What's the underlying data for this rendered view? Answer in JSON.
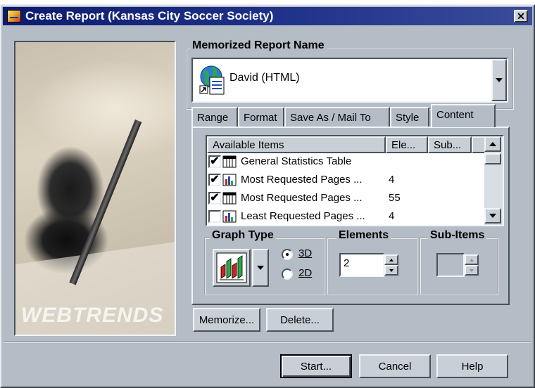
{
  "window": {
    "title": "Create Report (Kansas City Soccer Society)",
    "close_glyph": "✕"
  },
  "photo": {
    "watermark": "WEBTRENDS"
  },
  "memorized_report": {
    "group_label": "Memorized Report Name",
    "selected_value": "David (HTML)"
  },
  "tabs": [
    {
      "label": "Range"
    },
    {
      "label": "Format"
    },
    {
      "label": "Save As / Mail To"
    },
    {
      "label": "Style"
    },
    {
      "label": "Content",
      "active": true
    }
  ],
  "list": {
    "columns": [
      "Available Items",
      "Ele...",
      "Sub..."
    ],
    "rows": [
      {
        "checked": true,
        "icon": "table-icon",
        "name": "General Statistics Table",
        "elements": ""
      },
      {
        "checked": true,
        "icon": "bar-chart-icon",
        "name": "Most Requested Pages ...",
        "elements": "4"
      },
      {
        "checked": true,
        "icon": "table-icon",
        "name": "Most Requested Pages ...",
        "elements": "55"
      },
      {
        "checked": false,
        "icon": "bar-chart-icon",
        "name": "Least Requested Pages ...",
        "elements": "4"
      }
    ]
  },
  "graph_type": {
    "group_label": "Graph Type",
    "option_3d": "3D",
    "option_2d": "2D",
    "selected": "3D"
  },
  "elements": {
    "group_label": "Elements",
    "value": "2"
  },
  "sub_items": {
    "group_label": "Sub-Items",
    "value": ""
  },
  "buttons": {
    "memorize": "Memorize...",
    "delete": "Delete...",
    "start": "Start...",
    "cancel": "Cancel",
    "help": "Help"
  },
  "colors": {
    "dialog_bg": "#b4bcc6",
    "title_bar": "#0d1b6e"
  }
}
